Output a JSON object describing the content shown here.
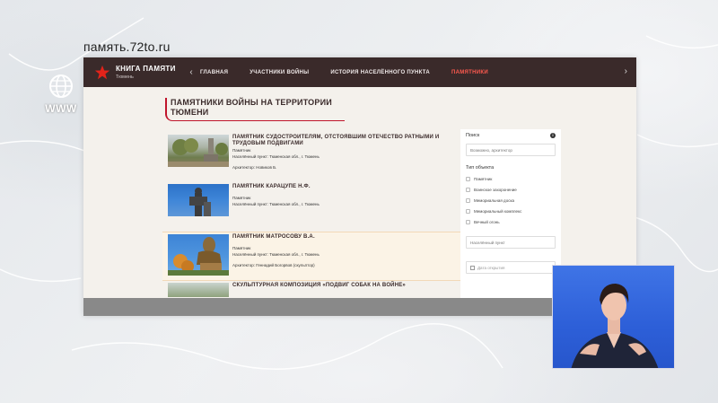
{
  "overlay": {
    "url": "память.72to.ru",
    "channel_label": "WWW"
  },
  "site": {
    "brand_title": "КНИГА ПАМЯТИ",
    "brand_sub": "Тюмень",
    "nav": [
      {
        "label": "ГЛАВНАЯ",
        "active": false
      },
      {
        "label": "УЧАСТНИКИ ВОЙНЫ",
        "active": false
      },
      {
        "label": "ИСТОРИЯ НАСЕЛЁННОГО ПУНКТА",
        "active": false
      },
      {
        "label": "ПАМЯТНИКИ",
        "active": true
      }
    ],
    "heading_line1": "ПАМЯТНИКИ ВОЙНЫ НА ТЕРРИТОРИИ",
    "heading_line2": "ТЮМЕНИ"
  },
  "items": [
    {
      "title": "ПАМЯТНИК СУДОСТРОИТЕЛЯМ, ОТСТОЯВШИМ ОТЕЧЕСТВО РАТНЫМИ И ТРУДОВЫМ ПОДВИГАМИ",
      "type": "Памятник",
      "place": "Населённый пункт: Тюменская обл., г. Тюмень",
      "architect": "Архитектор: Новиков Б."
    },
    {
      "title": "ПАМЯТНИК КАРАЦУПЕ Н.Ф.",
      "type": "Памятник",
      "place": "Населённый пункт: Тюменская обл., г. Тюмень",
      "architect": ""
    },
    {
      "title": "ПАМЯТНИК МАТРОСОВУ В.А.",
      "type": "Памятник",
      "place": "Населённый пункт: Тюменская обл., г. Тюмень",
      "architect": "Архитектор: Геннадий Богорвов (скульптор)"
    },
    {
      "title": "СКУЛЬПТУРНАЯ КОМПОЗИЦИЯ «ПОДВИГ СОБАК НА ВОЙНЕ»",
      "type": "",
      "place": "",
      "architect": ""
    }
  ],
  "filter": {
    "search_label": "Поиск",
    "search_placeholder": "Возможно, архитектор",
    "type_label": "Тип объекта",
    "options": [
      "Памятник",
      "Воинское захоронение",
      "Мемориальная доска",
      "Мемориальный комплекс",
      "Вечный огонь"
    ],
    "place_placeholder": "Населённый пункт",
    "date_placeholder": "Дата открытия"
  },
  "colors": {
    "nav_bg": "#3a2a2a",
    "accent": "#c0152c",
    "active_nav": "#ff5a4f"
  }
}
